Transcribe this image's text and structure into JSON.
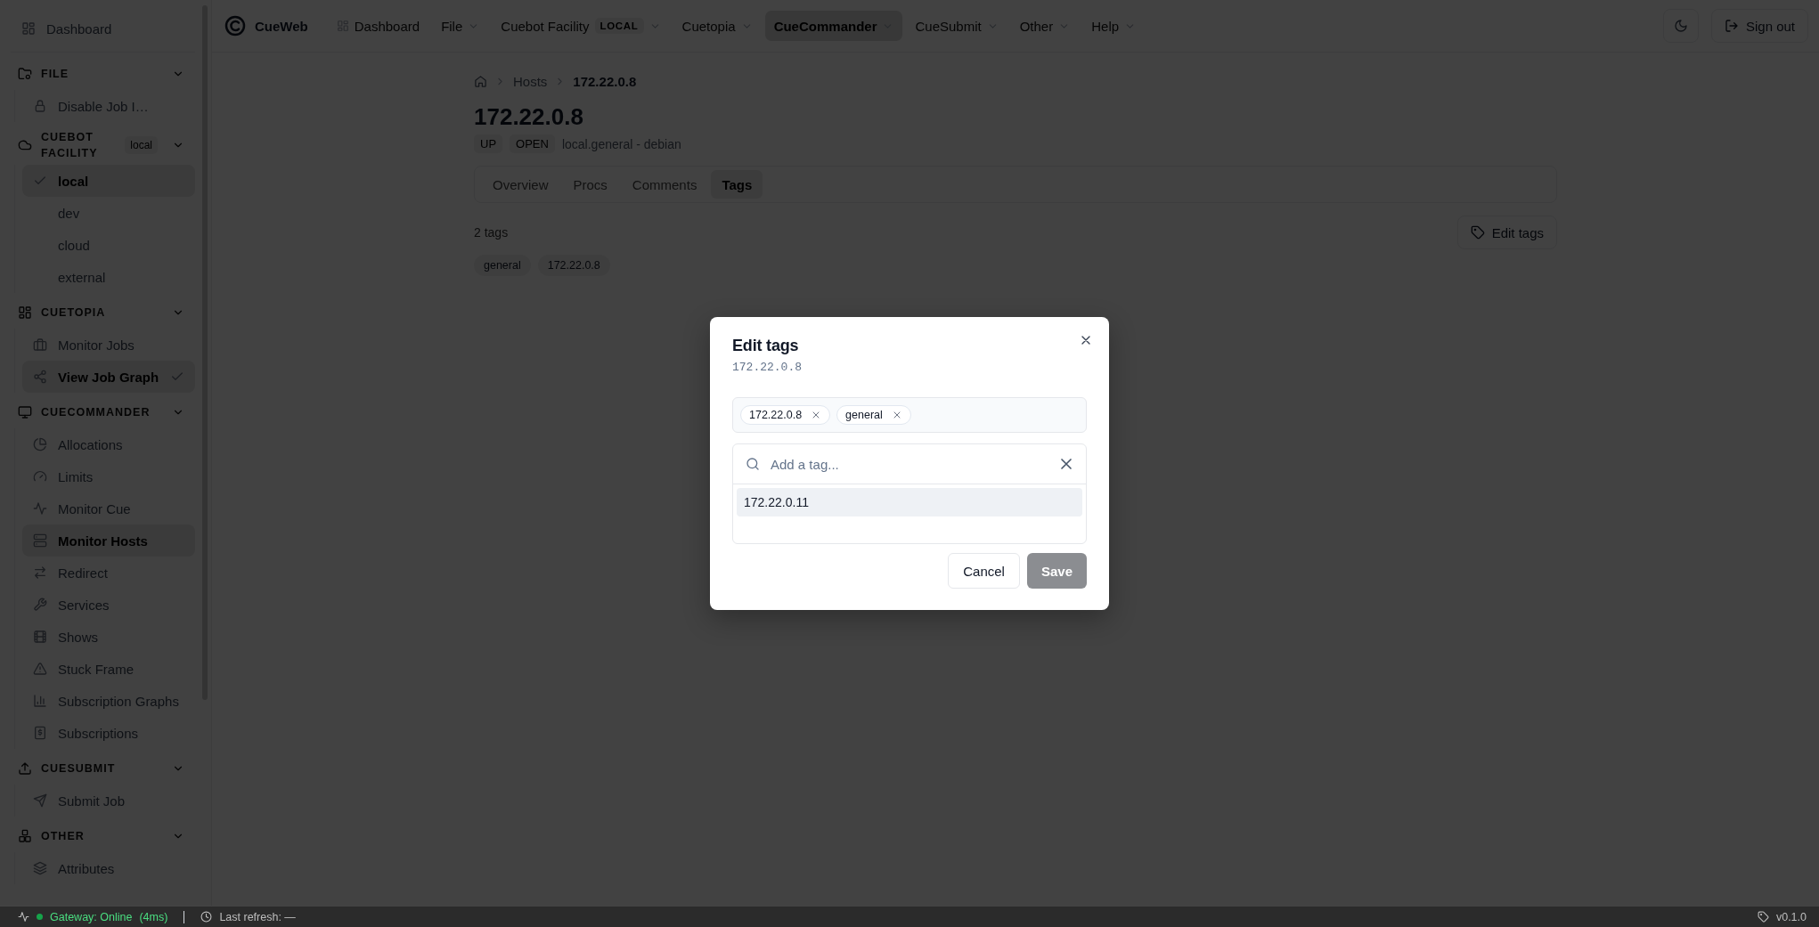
{
  "sidebar": {
    "top_item": {
      "label": "Dashboard",
      "selected": false
    },
    "sections": [
      {
        "title": "FILE",
        "kind": "links",
        "expanded": true,
        "items": [
          {
            "label": "Disable Job I…",
            "selected": false,
            "checked": false
          }
        ]
      },
      {
        "title": "CUEBOT FACILITY",
        "badge": "local",
        "kind": "choices",
        "expanded": true,
        "items": [
          {
            "label": "local",
            "selected": true
          },
          {
            "label": "dev",
            "selected": false
          },
          {
            "label": "cloud",
            "selected": false
          },
          {
            "label": "external",
            "selected": false
          }
        ]
      },
      {
        "title": "CUETOPIA",
        "kind": "links",
        "expanded": true,
        "items": [
          {
            "label": "Monitor Jobs",
            "selected": false,
            "checked": false
          },
          {
            "label": "View Job Graph",
            "selected": true,
            "checked": true
          }
        ]
      },
      {
        "title": "CUECOMMANDER",
        "kind": "links",
        "expanded": true,
        "items": [
          {
            "label": "Allocations",
            "selected": false,
            "checked": false
          },
          {
            "label": "Limits",
            "selected": false,
            "checked": false
          },
          {
            "label": "Monitor Cue",
            "selected": false,
            "checked": false
          },
          {
            "label": "Monitor Hosts",
            "selected": true,
            "checked": false
          },
          {
            "label": "Redirect",
            "selected": false,
            "checked": false
          },
          {
            "label": "Services",
            "selected": false,
            "checked": false
          },
          {
            "label": "Shows",
            "selected": false,
            "checked": false
          },
          {
            "label": "Stuck Frame",
            "selected": false,
            "checked": false
          },
          {
            "label": "Subscription Graphs",
            "selected": false,
            "checked": false
          },
          {
            "label": "Subscriptions",
            "selected": false,
            "checked": false
          }
        ]
      },
      {
        "title": "CUESUBMIT",
        "kind": "links",
        "expanded": true,
        "items": [
          {
            "label": "Submit Job",
            "selected": false,
            "checked": false
          }
        ]
      },
      {
        "title": "OTHER",
        "kind": "links",
        "expanded": true,
        "items": [
          {
            "label": "Attributes",
            "selected": false,
            "checked": false
          }
        ]
      }
    ]
  },
  "topbar": {
    "brand": "CueWeb",
    "nav": [
      {
        "label": "Dashboard",
        "kind": "link",
        "selected": false
      },
      {
        "label": "File",
        "kind": "menu",
        "selected": false
      },
      {
        "label": "Cuebot Facility",
        "kind": "menu",
        "selected": false,
        "badge": "LOCAL"
      },
      {
        "label": "Cuetopia",
        "kind": "menu",
        "selected": false
      },
      {
        "label": "CueCommander",
        "kind": "menu",
        "selected": true
      },
      {
        "label": "CueSubmit",
        "kind": "menu",
        "selected": false
      },
      {
        "label": "Other",
        "kind": "menu",
        "selected": false
      },
      {
        "label": "Help",
        "kind": "menu",
        "selected": false
      }
    ],
    "sign_out": "Sign out"
  },
  "page": {
    "breadcrumb": [
      "Hosts",
      "172.22.0.8"
    ],
    "title": "172.22.0.8",
    "badges": [
      "UP",
      "OPEN"
    ],
    "subtitle": "local.general - debian",
    "tabs": [
      {
        "label": "Overview",
        "selected": false
      },
      {
        "label": "Procs",
        "selected": false
      },
      {
        "label": "Comments",
        "selected": false
      },
      {
        "label": "Tags",
        "selected": true
      }
    ],
    "tag_count": "2 tags",
    "edit_button": "Edit tags",
    "tags": [
      "general",
      "172.22.0.8"
    ]
  },
  "dialog": {
    "title": "Edit tags",
    "subtitle": "172.22.0.8",
    "selected_tags": [
      "172.22.0.8",
      "general"
    ],
    "search": {
      "placeholder": "Add a tag..."
    },
    "suggestions": [
      {
        "label": "172.22.0.11",
        "selected": true
      }
    ],
    "cancel": "Cancel",
    "save": {
      "label": "Save",
      "disabled": true
    }
  },
  "status_bar": {
    "gateway": "Gateway: Online",
    "online": true,
    "latency": "(4ms)",
    "refresh": "Last refresh: —",
    "version": "v0.1.0"
  }
}
